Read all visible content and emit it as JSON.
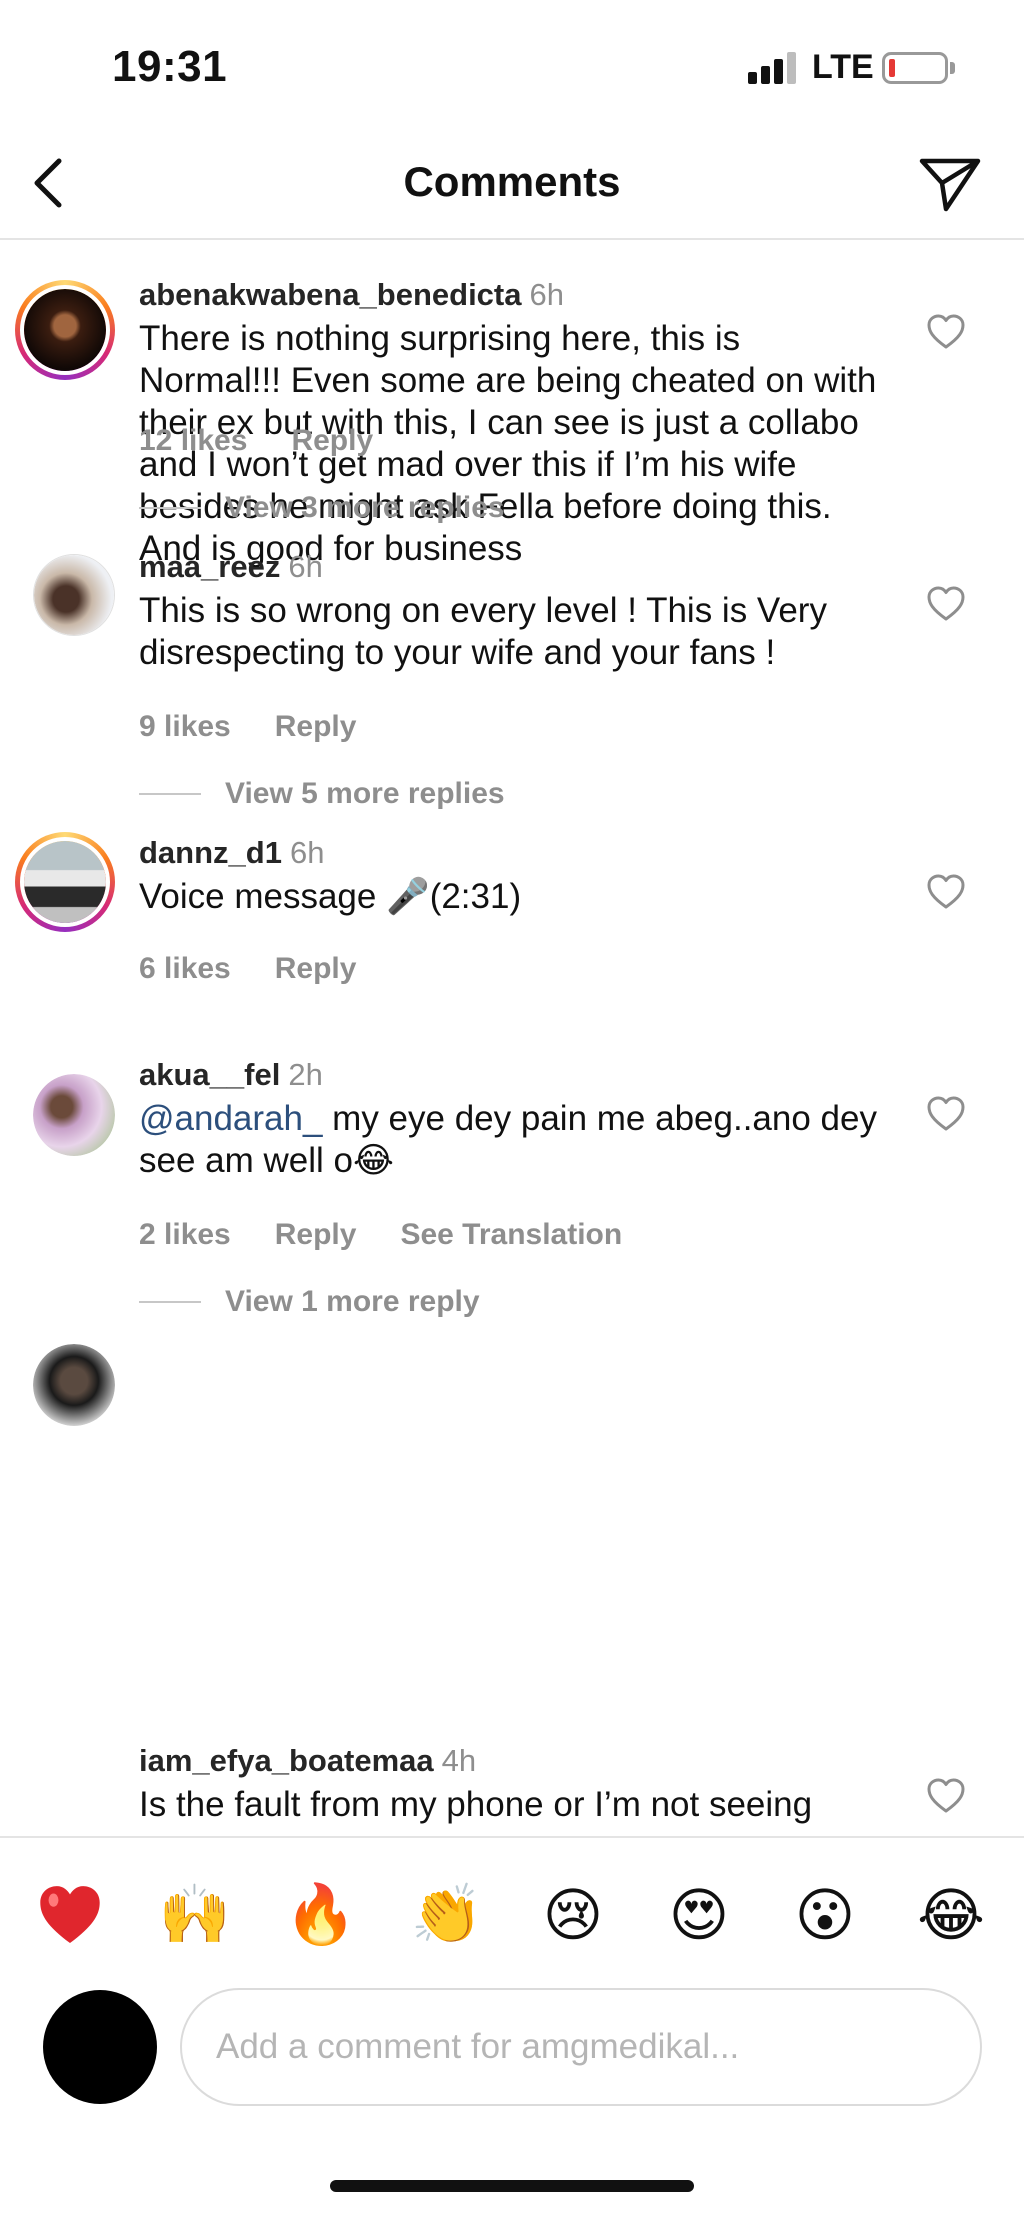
{
  "status_bar": {
    "time": "19:31",
    "network": "LTE",
    "battery_level": 0.1
  },
  "header": {
    "title": "Comments",
    "back_icon": "chevron-left-icon",
    "send_icon": "paper-plane-icon"
  },
  "comments": [
    {
      "username": "abenakwabena_benedicta",
      "time": "6h",
      "text": "There is nothing surprising here, this is Normal!!! Even some are being cheated on with their ex but with this, I can see is just a collabo and I won’t get mad over this if I’m his wife besides he might ask Fella before doing this. And is good for business",
      "likes": "12 likes",
      "reply": "Reply",
      "view_more": "View 3 more replies"
    },
    {
      "username": "maa_reez",
      "time": "6h",
      "text": "This is so wrong on every level ! This is Very disrespecting to your wife and your fans !",
      "likes": "9 likes",
      "reply": "Reply",
      "view_more": "View 5 more replies"
    },
    {
      "username": "dannz_d1",
      "time": "6h",
      "text_before": "Voice message ",
      "emoji": "🎤",
      "text_after": "(2:31)",
      "likes": "6 likes",
      "reply": "Reply"
    },
    {
      "username": "akua__fel",
      "time": "2h",
      "mention": "@andarah_",
      "text": " my eye dey pain me abeg..ano dey see am well o",
      "emoji": "😂",
      "likes": "2 likes",
      "reply": "Reply",
      "translate": "See Translation",
      "view_more": "View 1 more reply"
    },
    {
      "username": "iam_efya_boatemaa",
      "time": "4h",
      "text": "Is the fault from my phone or I’m not seeing"
    }
  ],
  "reactions": [
    "❤️",
    "🙌",
    "🔥",
    "👏",
    "😢",
    "😍",
    "😮",
    "😂"
  ],
  "composer": {
    "placeholder": "Add a comment for amgmedikal..."
  },
  "colors": {
    "link": "#2c4f7c",
    "muted": "#8e8e8e",
    "battery_low": "#e53935"
  }
}
